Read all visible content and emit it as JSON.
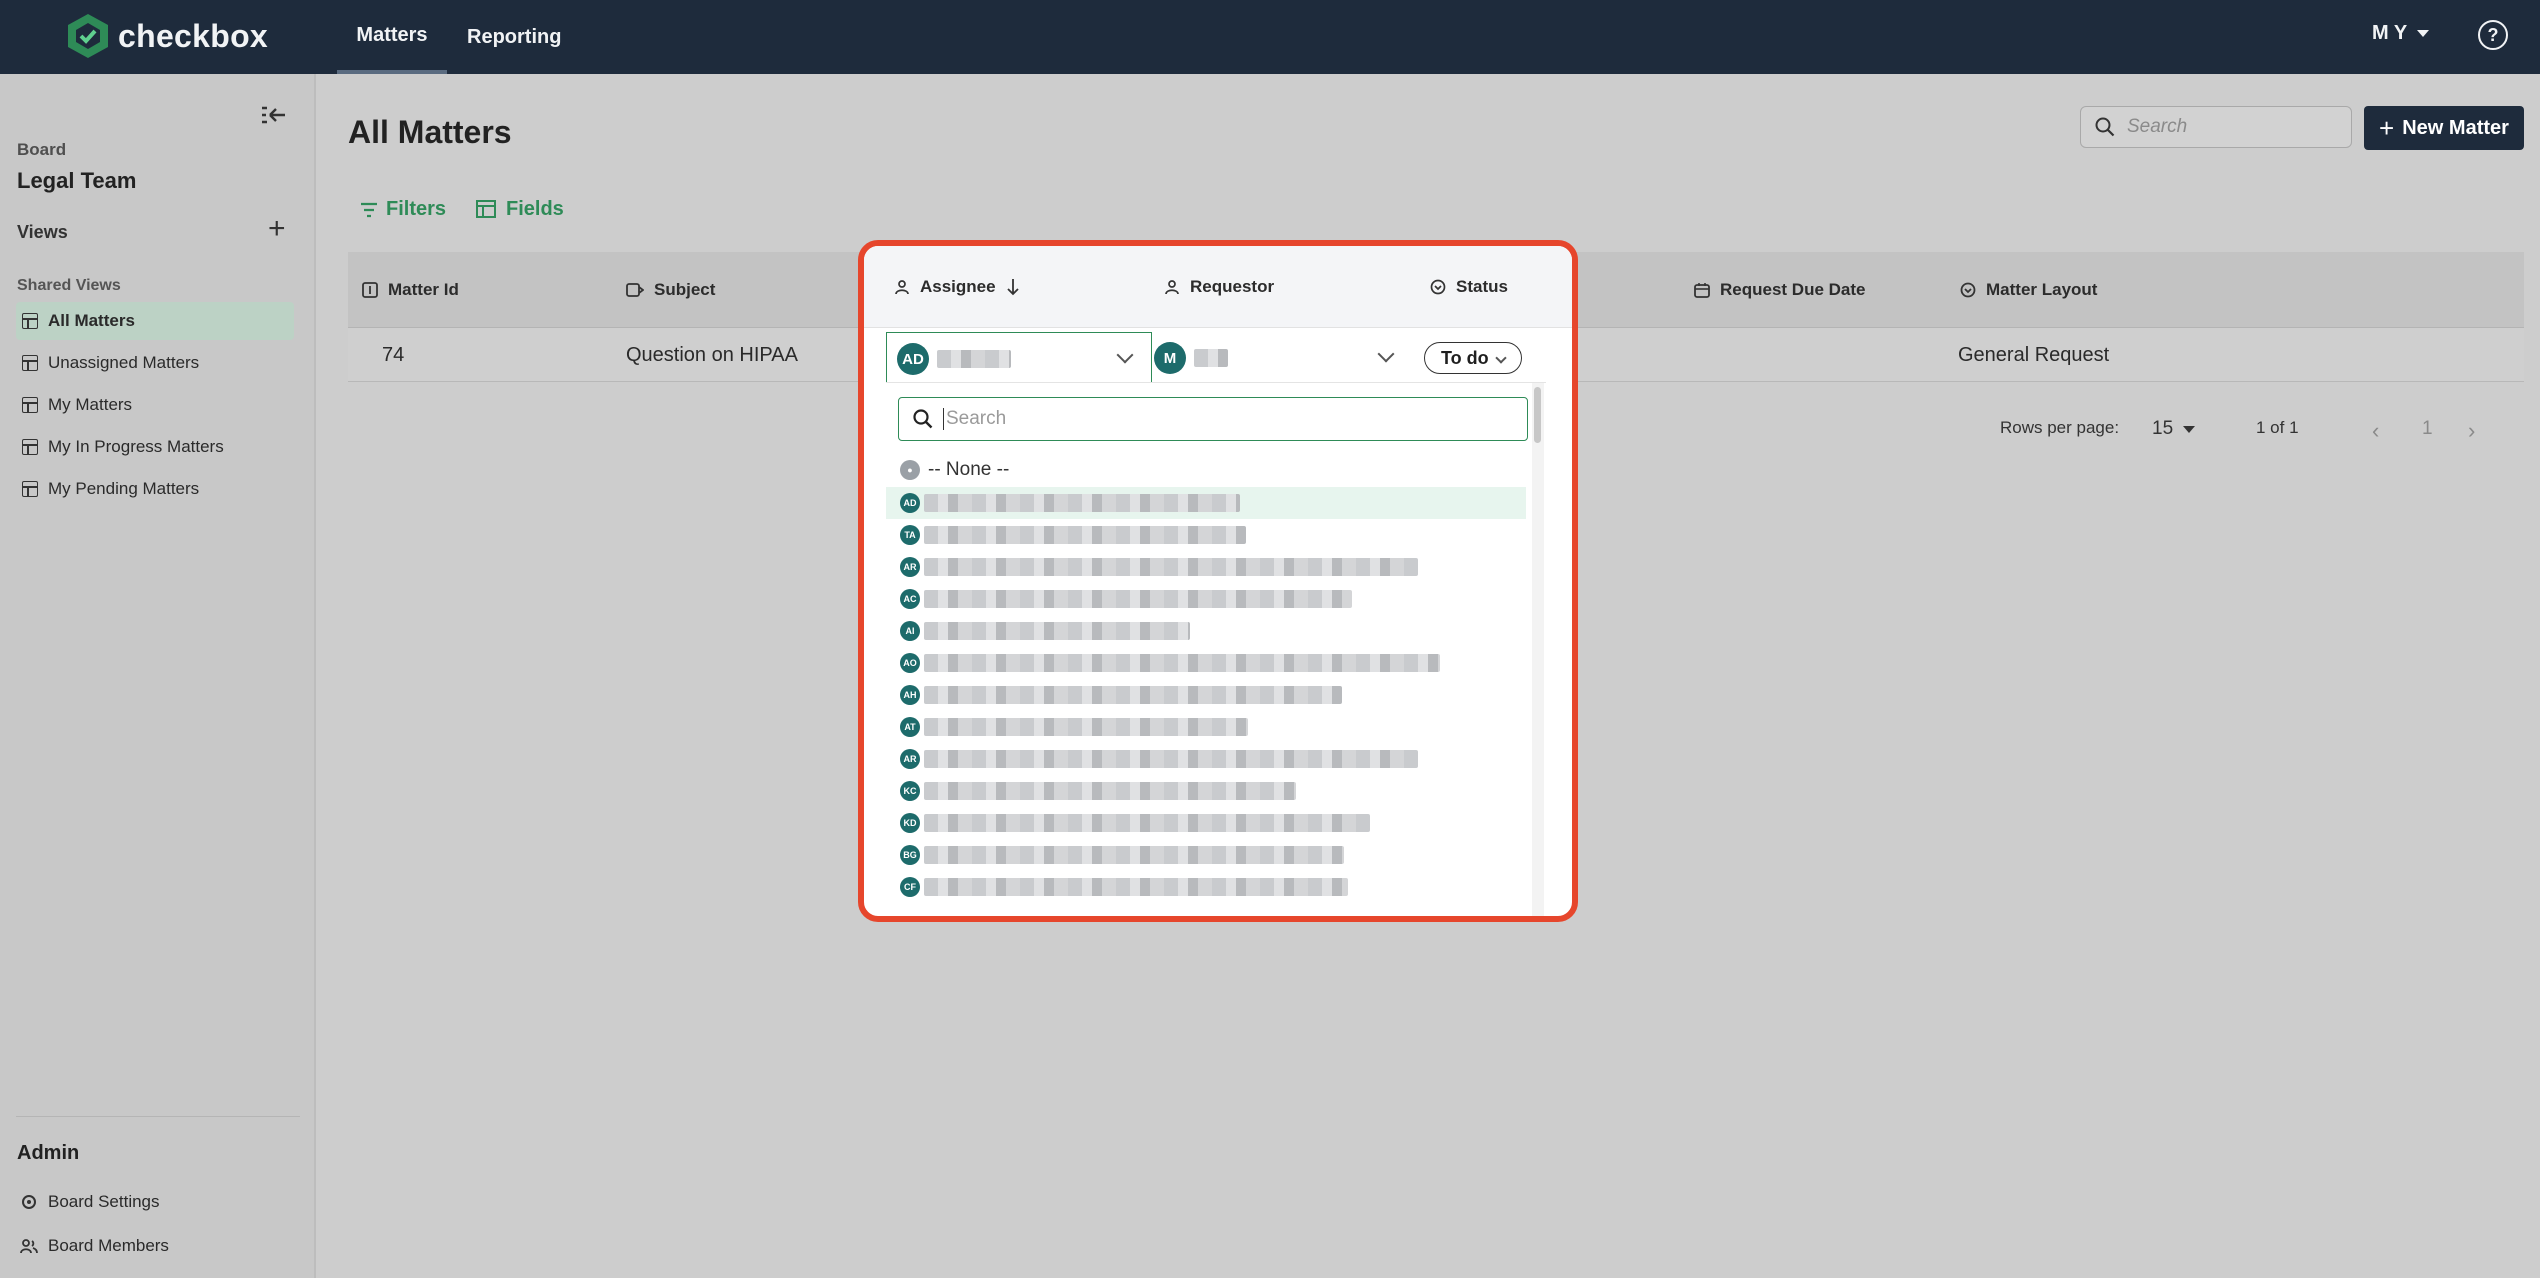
{
  "app": {
    "name": "checkbox"
  },
  "nav": {
    "tabs": [
      "Matters",
      "Reporting"
    ],
    "active": "Matters",
    "user_initials": "M Y"
  },
  "sidebar": {
    "board_label": "Board",
    "board_name": "Legal Team",
    "views_label": "Views",
    "shared_views_label": "Shared Views",
    "items": [
      "All Matters",
      "Unassigned Matters",
      "My Matters",
      "My In Progress Matters",
      "My Pending Matters"
    ],
    "admin_label": "Admin",
    "admin_items": [
      "Board Settings",
      "Board Members"
    ]
  },
  "main": {
    "title": "All Matters",
    "search_placeholder": "Search",
    "new_button": "New Matter",
    "filters_label": "Filters",
    "fields_label": "Fields",
    "columns": [
      "Matter Id",
      "Subject",
      "Assignee",
      "Requestor",
      "Status",
      "Request Due Date",
      "Matter Layout"
    ],
    "rows": [
      {
        "matter_id": "74",
        "subject": "Question on HIPAA",
        "assignee_initials": "AD",
        "requestor_initials": "M",
        "status": "To do",
        "matter_layout": "General Request"
      }
    ],
    "pagination": {
      "rows_per_page_label": "Rows per page:",
      "rows_per_page": "15",
      "range": "1 of 1",
      "page": "1"
    }
  },
  "dropdown": {
    "search_placeholder": "Search",
    "none_option": "-- None --",
    "options": [
      "AD",
      "TA",
      "AR",
      "AC",
      "AI",
      "AO",
      "AH",
      "AT",
      "AR",
      "KC",
      "KD",
      "BG",
      "CF"
    ]
  },
  "colors": {
    "nav_bg": "#1e2b3c",
    "accent": "#2e8b57",
    "highlight_frame": "#e6462c",
    "avatar": "#1d6b6b"
  }
}
